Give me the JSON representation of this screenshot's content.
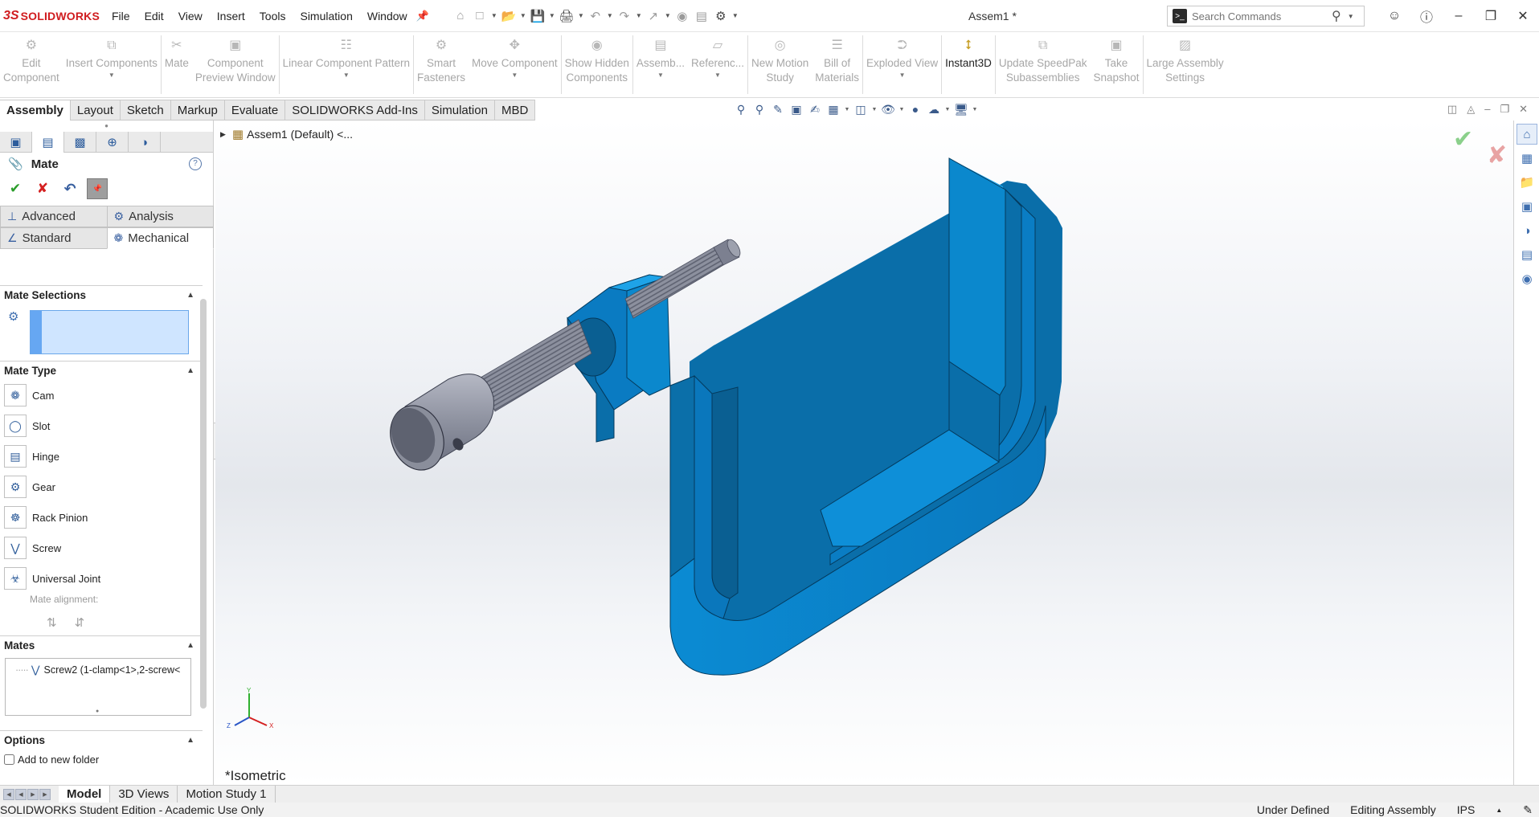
{
  "app": {
    "brand": "SOLIDWORKS",
    "doc_title": "Assem1 *"
  },
  "menu": [
    "File",
    "Edit",
    "View",
    "Insert",
    "Tools",
    "Simulation",
    "Window"
  ],
  "search": {
    "placeholder": "Search Commands"
  },
  "ribbon": [
    {
      "line1": "Edit",
      "line2": "Component",
      "icon": "edit-component-icon",
      "has_drop": false,
      "active": false
    },
    {
      "line1": "Insert Components",
      "line2": "",
      "icon": "insert-components-icon",
      "has_drop": true,
      "active": false
    },
    {
      "line1": "Mate",
      "line2": "",
      "icon": "mate-icon",
      "has_drop": false,
      "active": false
    },
    {
      "line1": "Component",
      "line2": "Preview Window",
      "icon": "preview-window-icon",
      "has_drop": false,
      "active": false
    },
    {
      "line1": "Linear Component Pattern",
      "line2": "",
      "icon": "linear-pattern-icon",
      "has_drop": true,
      "active": false
    },
    {
      "line1": "Smart",
      "line2": "Fasteners",
      "icon": "smart-fasteners-icon",
      "has_drop": false,
      "active": false
    },
    {
      "line1": "Move Component",
      "line2": "",
      "icon": "move-component-icon",
      "has_drop": true,
      "active": false
    },
    {
      "line1": "Show Hidden",
      "line2": "Components",
      "icon": "show-hidden-icon",
      "has_drop": false,
      "active": false
    },
    {
      "line1": "Assemb...",
      "line2": "",
      "icon": "assembly-features-icon",
      "has_drop": true,
      "active": false
    },
    {
      "line1": "Referenc...",
      "line2": "",
      "icon": "reference-geometry-icon",
      "has_drop": true,
      "active": false
    },
    {
      "line1": "New Motion",
      "line2": "Study",
      "icon": "motion-study-icon",
      "has_drop": false,
      "active": false
    },
    {
      "line1": "Bill of",
      "line2": "Materials",
      "icon": "bom-icon",
      "has_drop": false,
      "active": false
    },
    {
      "line1": "Exploded View",
      "line2": "",
      "icon": "exploded-view-icon",
      "has_drop": true,
      "active": false
    },
    {
      "line1": "Instant3D",
      "line2": "",
      "icon": "instant3d-icon",
      "has_drop": false,
      "active": true
    },
    {
      "line1": "Update SpeedPak",
      "line2": "Subassemblies",
      "icon": "speedpak-icon",
      "has_drop": false,
      "active": false
    },
    {
      "line1": "Take",
      "line2": "Snapshot",
      "icon": "snapshot-icon",
      "has_drop": false,
      "active": false
    },
    {
      "line1": "Large Assembly",
      "line2": "Settings",
      "icon": "large-assembly-icon",
      "has_drop": false,
      "active": false
    }
  ],
  "tabs": [
    "Assembly",
    "Layout",
    "Sketch",
    "Markup",
    "Evaluate",
    "SOLIDWORKS Add-Ins",
    "Simulation",
    "MBD"
  ],
  "active_tab": "Assembly",
  "property_manager": {
    "title": "Mate",
    "help": "?",
    "mate_tabs_top": [
      "Advanced",
      "Analysis"
    ],
    "mate_tabs_bottom": [
      "Standard",
      "Mechanical"
    ],
    "active_mate_tab": "Mechanical",
    "mate_selections_label": "Mate Selections",
    "mate_type_label": "Mate Type",
    "mate_types": [
      {
        "label": "Cam",
        "icon": "cam-mate-icon"
      },
      {
        "label": "Slot",
        "icon": "slot-mate-icon"
      },
      {
        "label": "Hinge",
        "icon": "hinge-mate-icon"
      },
      {
        "label": "Gear",
        "icon": "gear-mate-icon"
      },
      {
        "label": "Rack Pinion",
        "icon": "rack-pinion-mate-icon"
      },
      {
        "label": "Screw",
        "icon": "screw-mate-icon"
      },
      {
        "label": "Universal Joint",
        "icon": "universal-joint-mate-icon"
      }
    ],
    "mate_alignment_label": "Mate alignment:",
    "mates_label": "Mates",
    "mates": [
      "Screw2 (1-clamp<1>,2-screw<"
    ],
    "options_label": "Options",
    "add_to_folder_label": "Add to new folder"
  },
  "tree": {
    "root": "Assem1 (Default) <..."
  },
  "view_label": "*Isometric",
  "triad": {
    "x": "X",
    "y": "Y",
    "z": "Z"
  },
  "bottom_tabs": [
    "Model",
    "3D Views",
    "Motion Study 1"
  ],
  "active_bottom_tab": "Model",
  "status": {
    "edition": "SOLIDWORKS Student Edition - Academic Use Only",
    "state": "Under Defined",
    "mode": "Editing Assembly",
    "units": "IPS"
  },
  "colors": {
    "accent": "#1a8fd6",
    "clamp_blue": "#0a86cf",
    "screw_grey": "#8a8f9c",
    "brand_red": "#d01c1f"
  }
}
